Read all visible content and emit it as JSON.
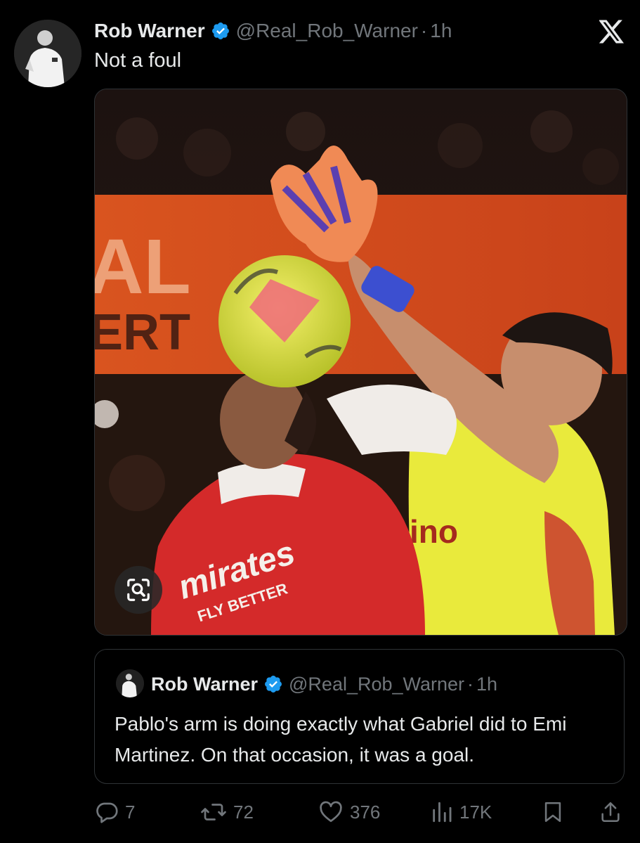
{
  "tweet": {
    "author": {
      "name": "Rob Warner",
      "handle": "@Real_Rob_Warner",
      "verified": true,
      "avatar_icon": "avatar-photo"
    },
    "separator": "·",
    "time": "1h",
    "text": "Not a foul",
    "media": {
      "type": "photo",
      "lens_icon": "visual-search-icon",
      "visible_text": [
        "AL",
        "ERT",
        "mirates",
        "FLY BETTER",
        "ino"
      ]
    }
  },
  "quoted_tweet": {
    "author": {
      "name": "Rob Warner",
      "handle": "@Real_Rob_Warner",
      "verified": true
    },
    "separator": "·",
    "time": "1h",
    "text": "Pablo's arm is doing exactly what Gabriel did to Emi Martinez. On that occasion, it was a goal."
  },
  "actions": {
    "replies": "7",
    "reposts": "72",
    "likes": "376",
    "views": "17K"
  },
  "branding": {
    "logo": "x-logo"
  },
  "colors": {
    "background": "#000000",
    "text_primary": "#e7e9ea",
    "text_secondary": "#71767b",
    "verified_blue": "#1d9bf0",
    "border": "#2f3336"
  }
}
